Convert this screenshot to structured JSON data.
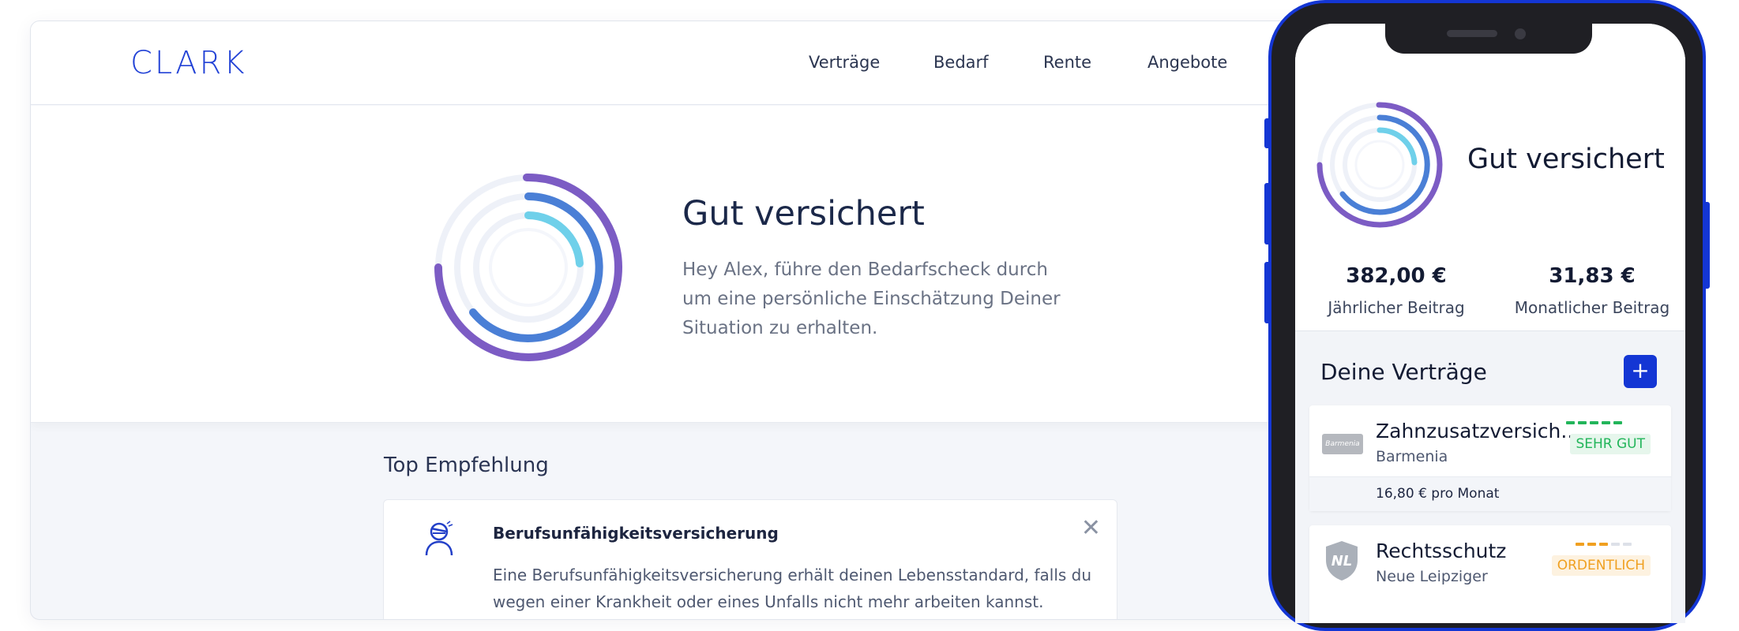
{
  "desktop": {
    "logo": "CLARK",
    "nav": [
      "Verträge",
      "Bedarf",
      "Rente",
      "Angebote"
    ],
    "hero": {
      "title": "Gut versichert",
      "text": "Hey Alex, führe den Bedarfscheck durch um eine persönliche Einschätzung Deiner Situation zu erhalten."
    },
    "recommendation": {
      "section_title": "Top Empfehlung",
      "card_title": "Berufsunfähigkeitsversicherung",
      "card_text": "Eine Berufsunfähigkeitsversicherung erhält deinen Lebensstandard, falls du wegen einer Krankheit oder eines Unfalls nicht mehr arbeiten kannst.",
      "close_icon": "close-icon"
    }
  },
  "phone": {
    "title": "Gut versichert",
    "stats": [
      {
        "value": "382,00 €",
        "label": "Jährlicher Beitrag"
      },
      {
        "value": "31,83 €",
        "label": "Monatlicher Beitrag"
      }
    ],
    "section_title": "Deine Verträge",
    "add_label": "+",
    "contracts": [
      {
        "name": "Zahnzusatzversich...",
        "insurer": "Barmenia",
        "logo_text": "Barmenia",
        "rating": "SEHR GUT",
        "rating_level": 5,
        "price": "16,80 € pro Monat"
      },
      {
        "name": "Rechtsschutz",
        "insurer": "Neue Leipziger",
        "logo_text": "NL",
        "rating": "ORDENTLICH",
        "rating_level": 3
      }
    ]
  },
  "colors": {
    "brand_blue": "#1436d4",
    "ring_purple": "#7c5cc4",
    "ring_blue": "#4a7fd6",
    "ring_cyan": "#6fd0ea",
    "good_green": "#22b55a",
    "ok_orange": "#f0a020"
  }
}
